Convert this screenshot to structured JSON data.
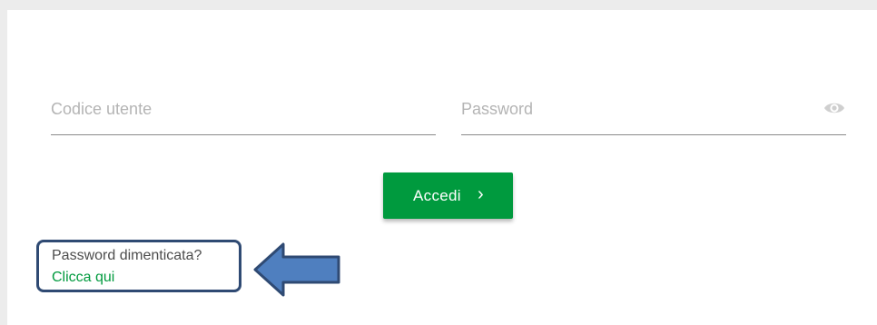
{
  "login": {
    "username_placeholder": "Codice utente",
    "password_placeholder": "Password",
    "submit_label": "Accedi",
    "submit_chevron": "›",
    "forgot_text": "Password dimenticata?",
    "forgot_link": "Clicca qui"
  },
  "icons": {
    "password_visibility": "eye-icon",
    "submit": "chevron-right-icon",
    "annotation": "arrow-left-icon"
  },
  "colors": {
    "primary": "#009a3e",
    "link": "#009a3e",
    "annotation_border": "#2f4a73",
    "annotation_fill": "#4f7fbf"
  }
}
